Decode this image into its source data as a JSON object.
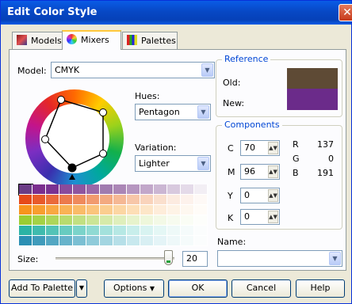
{
  "window": {
    "title": "Edit Color Style",
    "close_label": "✕"
  },
  "tabs": [
    {
      "label": "Models",
      "icon": "models-icon"
    },
    {
      "label": "Mixers",
      "icon": "mixers-icon"
    },
    {
      "label": "Palettes",
      "icon": "palettes-icon"
    }
  ],
  "mixers": {
    "model_label": "Model:",
    "model_value": "CMYK",
    "hues_label": "Hues:",
    "hues_value": "Pentagon",
    "variation_label": "Variation:",
    "variation_value": "Lighter",
    "size_label": "Size:",
    "size_value": "20",
    "size_slider_fraction": 0.95,
    "name_label": "Name:",
    "name_value": ""
  },
  "reference": {
    "title": "Reference",
    "old_label": "Old:",
    "new_label": "New:",
    "old_color": "#5e4a35",
    "new_color": "#6b2b8a"
  },
  "components": {
    "title": "Components",
    "c_label": "C",
    "c_value": "70",
    "m_label": "M",
    "m_value": "96",
    "y_label": "Y",
    "y_value": "0",
    "k_label": "K",
    "k_value": "0",
    "r_label": "R",
    "r_value": "137",
    "g_label": "G",
    "g_value": "0",
    "b_label": "B",
    "b_value": "191"
  },
  "swatch_rows": [
    [
      "#6b3c86",
      "#7b2e8e",
      "#7a3292",
      "#8a4b9c",
      "#8f559f",
      "#9a68a8",
      "#a07baf",
      "#ab86b6",
      "#b696c0",
      "#c2a7ca",
      "#cbb6d3",
      "#d8c9de",
      "#e4dae9",
      "#f2eef4"
    ],
    [
      "#e64a19",
      "#e85a2a",
      "#ea6a3a",
      "#ec7a4c",
      "#ef8a5c",
      "#f19a6e",
      "#f3a980",
      "#f5b894",
      "#f7c6a8",
      "#f9d3bb",
      "#fadfcd",
      "#fcebe0",
      "#fdf2ec",
      "#fef9f6"
    ],
    [
      "#f7941d",
      "#f89e2f",
      "#f9a842",
      "#f9b255",
      "#fabb68",
      "#fbc47c",
      "#fbcd8f",
      "#fcd6a3",
      "#fddeb6",
      "#fde6c8",
      "#feedda",
      "#fef3e6",
      "#fef8f0",
      "#fffcf8"
    ],
    [
      "#9acd32",
      "#a4d246",
      "#aed65a",
      "#b8db6e",
      "#c2e082",
      "#cce596",
      "#d6eaa9",
      "#dfefbc",
      "#e7f3cc",
      "#eef7db",
      "#f3f9e6",
      "#f7fbef",
      "#fafdf5",
      "#fdfefb"
    ],
    [
      "#2bb3a5",
      "#3fbbae",
      "#53c3b7",
      "#67cbc0",
      "#7bd3ca",
      "#8fdad3",
      "#a3e1dc",
      "#b6e8e4",
      "#c8eeeb",
      "#d8f3f1",
      "#e4f7f5",
      "#eef9f8",
      "#f5fbfb",
      "#fbfdfd"
    ],
    [
      "#2b8fb3",
      "#3f9bbb",
      "#53a7c3",
      "#67b3cb",
      "#7bbfd3",
      "#8fcbda",
      "#a3d5e1",
      "#b6dfe8",
      "#c8e8ee",
      "#d8eff3",
      "#e4f4f7",
      "#eef8f9",
      "#f5fbfb",
      "#fbfdfd"
    ]
  ],
  "footer": {
    "add_to_palette": "Add To Palette",
    "options": "Options",
    "ok": "OK",
    "cancel": "Cancel",
    "help": "Help"
  }
}
